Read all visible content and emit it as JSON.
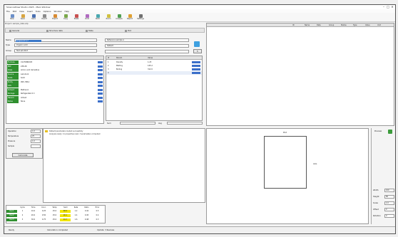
{
  "app": {
    "title": "ScienceDraw Studio 2023 - Main Window"
  },
  "window_controls": {
    "minimize": "–",
    "maximize": "□",
    "close": "✕"
  },
  "menu": [
    "File",
    "Edit",
    "View",
    "Insert",
    "Tools",
    "Options",
    "Window",
    "Help"
  ],
  "toolbar": [
    {
      "label": "New",
      "icon": "new-file-icon",
      "color": "#6b8fc8"
    },
    {
      "label": "Open",
      "icon": "folder-icon",
      "color": "#d8a540"
    },
    {
      "label": "Save",
      "icon": "save-icon",
      "color": "#4a6fb0"
    },
    {
      "label": "Import",
      "icon": "import-icon",
      "color": "#8a8a8a"
    },
    {
      "label": "Export",
      "icon": "export-icon",
      "color": "#d88a30"
    },
    {
      "label": "Copy",
      "icon": "copy-icon",
      "color": "#7aa84a"
    },
    {
      "label": "Paste",
      "icon": "paste-icon",
      "color": "#c85050"
    },
    {
      "label": "Undo",
      "icon": "undo-icon",
      "color": "#b06ac0"
    },
    {
      "label": "Redo",
      "icon": "redo-icon",
      "color": "#4aa8b0"
    },
    {
      "label": "Zoom",
      "icon": "zoom-icon",
      "color": "#d0c040"
    },
    {
      "label": "Analyze",
      "icon": "chart-icon",
      "color": "#50a050"
    },
    {
      "label": "Report",
      "icon": "report-icon",
      "color": "#e0a030"
    },
    {
      "label": "Settings",
      "icon": "gear-icon",
      "color": "#707070"
    }
  ],
  "fileinfo": "Project: sample_data.sdp",
  "tabs": [
    "General",
    "Structure data",
    "Table",
    "Plot"
  ],
  "left_form": {
    "name_label": "Name",
    "name_value": "Compound A-7",
    "type_label": "Type",
    "type_value": "Organic solid",
    "group_label": "Group",
    "group_value": "Test set 2023",
    "right_value1": "Reference sample A",
    "right_value2": "Default"
  },
  "property_list": [
    {
      "key": "Formula",
      "value": "C12H18N2O3"
    },
    {
      "key": "MW",
      "value": "238.28"
    },
    {
      "key": "Class",
      "value": "Amino acid derivative"
    },
    {
      "key": "Source",
      "value": "Lab stock"
    },
    {
      "key": "State",
      "value": "Solid"
    },
    {
      "key": "Purity",
      "value": "99% HPLC"
    },
    {
      "key": "CAS",
      "value": ""
    },
    {
      "key": "Solvent",
      "value": "Methanol"
    },
    {
      "key": "Storage",
      "value": "Refrigerated 4 C"
    },
    {
      "key": "Hazard",
      "value": "Irritant"
    },
    {
      "key": "Notes",
      "value": "None"
    }
  ],
  "center_table": {
    "header": [
      "#",
      "Param",
      "Value"
    ],
    "rows": [
      [
        "1",
        "Density",
        "1.23"
      ],
      [
        "2",
        "Melting",
        "145.2"
      ],
      [
        "3",
        "Boiling",
        "312.0"
      ],
      [
        "4",
        "",
        ""
      ]
    ],
    "footer_label1": "Sum",
    "footer_label2": "Avg"
  },
  "right_table": {
    "headers": [
      "ID",
      "Name",
      "Date",
      "Group",
      "Status",
      "Type",
      "Value",
      "Unit"
    ]
  },
  "left_mid": {
    "labels": [
      "Operation",
      "Temperature",
      "Pressure",
      "Sample"
    ],
    "values": [
      "1.0",
      "25",
      "1.0",
      ""
    ],
    "button": "Calculate",
    "log_line1": "Default parameters loaded successfully",
    "log_line2": "Analysis ready: 11 properties read, 3 parameters computed"
  },
  "bottom_table": {
    "headers": [
      "",
      "Cycle",
      "Time",
      "Conc.",
      "Temp",
      "Yield",
      "Rate",
      "Ratio",
      "Error"
    ],
    "rows": [
      [
        "Run1",
        "1",
        "10.0",
        "0.25",
        "25.0",
        "88.5",
        "1.2",
        "0.42",
        "0.5"
      ],
      [
        "Run2",
        "2",
        "20.0",
        "0.50",
        "25.0",
        "90.1",
        "1.4",
        "0.45",
        "0.4"
      ],
      [
        "Run3",
        "3",
        "30.0",
        "0.75",
        "25.0",
        "91.7",
        "1.6",
        "0.48",
        "0.3"
      ]
    ]
  },
  "plot_area": {
    "top_label": "Plot",
    "side_label": "Axis"
  },
  "right_panel": {
    "title": "Preview",
    "fields": [
      {
        "label": "Width",
        "value": "100"
      },
      {
        "label": "Height",
        "value": "80"
      },
      {
        "label": "Scale",
        "value": "1.0"
      },
      {
        "label": "Offset",
        "value": "0"
      },
      {
        "label": "Rotation",
        "value": "0"
      }
    ]
  },
  "status": {
    "left": "Ready",
    "mid": "Calculation completed",
    "right": "Update: 3 Reviews"
  }
}
